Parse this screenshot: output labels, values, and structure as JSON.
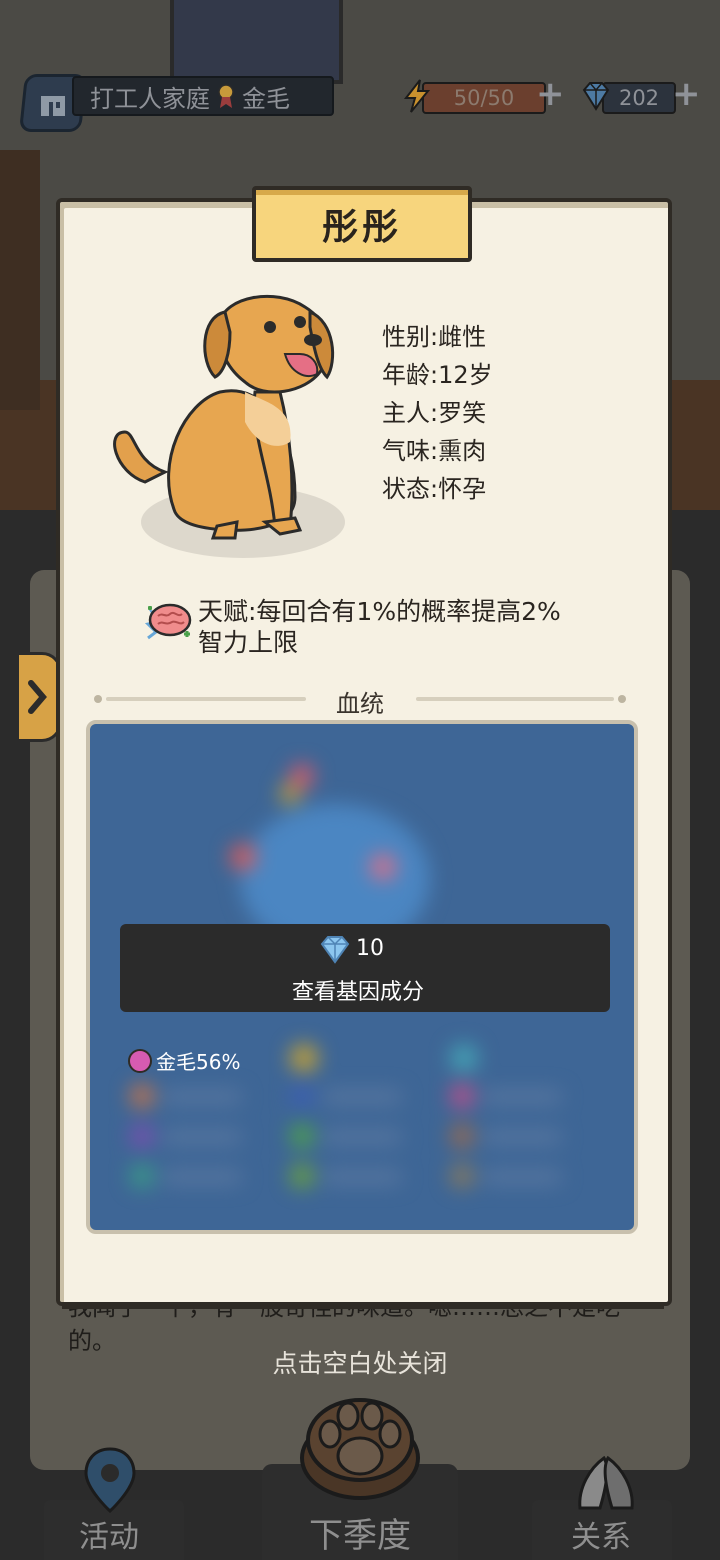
{
  "header": {
    "family_name": "打工人家庭",
    "breed_badge": "金毛",
    "energy": "50/50",
    "gems": "202"
  },
  "background": {
    "story_text": "我闻了一下，有一股奇怪的味道。嗯……总之不是吃的。"
  },
  "dog_card": {
    "name": "彤彤",
    "attributes": [
      {
        "text": "性别:雌性"
      },
      {
        "text": "年龄:12岁"
      },
      {
        "text": "主人:罗笑"
      },
      {
        "text": "气味:熏肉"
      },
      {
        "text": "状态:怀孕"
      }
    ],
    "talent": "天赋:每回合有1%的概率提高2%智力上限",
    "lineage_title": "血统",
    "unlock": {
      "cost": "10",
      "label": "查看基因成分"
    },
    "legend_visible": {
      "label": "金毛56%",
      "color": "#d65bb1"
    }
  },
  "close_hint": "点击空白处关闭",
  "bottom_nav": {
    "left": "活动",
    "center": "下季度",
    "right": "关系"
  },
  "icons": [
    "home-icon",
    "medal-icon",
    "energy-bolt-icon",
    "gem-icon",
    "plus-icon",
    "brain-icon",
    "paw-icon",
    "location-pin-icon",
    "hands-icon",
    "chevron-right-icon"
  ]
}
